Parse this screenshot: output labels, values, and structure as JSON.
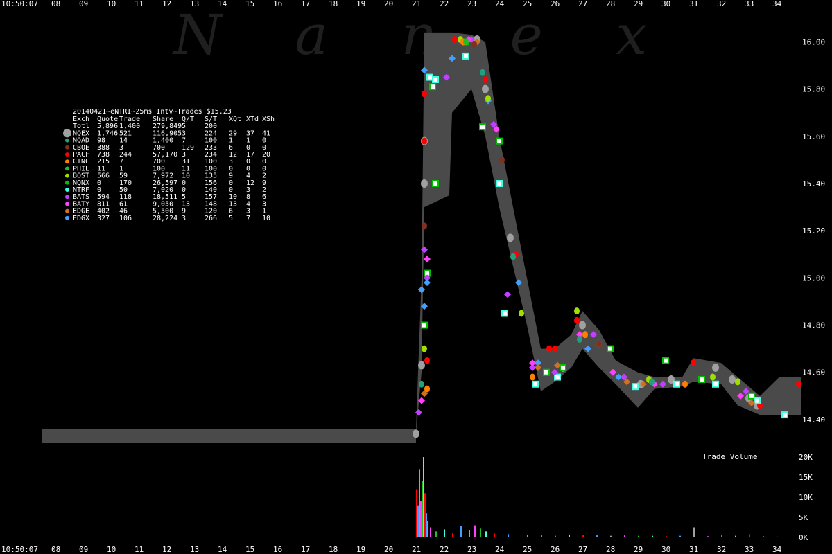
{
  "chart_data": [
    {
      "type": "scatter",
      "title": "20140421~eNTRI~25ms Intv~Trades $15.23",
      "watermark": "N a n e x",
      "time_labels": {
        "top_left": "10:50:07",
        "bottom_left": "10:50:07"
      },
      "x_ticks": [
        "08",
        "09",
        "10",
        "11",
        "12",
        "13",
        "14",
        "15",
        "16",
        "17",
        "18",
        "19",
        "20",
        "21",
        "22",
        "23",
        "24",
        "25",
        "26",
        "27",
        "28",
        "29",
        "30",
        "31",
        "32",
        "33",
        "34"
      ],
      "xlim": [
        7.5,
        35
      ],
      "ylim": [
        14.3,
        16.06
      ],
      "y_ticks": [
        "14.40",
        "14.60",
        "14.80",
        "15.00",
        "15.20",
        "15.40",
        "15.60",
        "15.80",
        "16.00"
      ],
      "colors": {
        "NQEX": "#a0a0a0",
        "NQAD": "#20a080",
        "CBOE": "#803020",
        "PACF": "#ff0000",
        "CINC": "#ff8000",
        "PHIL": "#20c020",
        "BOST": "#a0e000",
        "NQNX": "#00c000",
        "NTRF": "#40ffe0",
        "BATS": "#c040ff",
        "BATY": "#ff40ff",
        "EDGE": "#d07020",
        "EDGX": "#40a0ff",
        "spread": "#4a4a4a"
      },
      "table": {
        "headers": [
          "Exch",
          "Quote",
          "Trade",
          "Share",
          "Q/T",
          "S/T",
          "XQt",
          "XTd",
          "XSh"
        ],
        "total": [
          "Totl",
          "5,896",
          "1,400",
          "279,849",
          "5",
          "200",
          "",
          "",
          ""
        ],
        "rows": [
          [
            "NQEX",
            "1,746",
            "521",
            "116,905",
            "3",
            "224",
            "29",
            "37",
            "41"
          ],
          [
            "NQAD",
            "98",
            "14",
            "1,400",
            "7",
            "100",
            "1",
            "1",
            "0"
          ],
          [
            "CBOE",
            "388",
            "3",
            "700",
            "129",
            "233",
            "6",
            "0",
            "0"
          ],
          [
            "PACF",
            "738",
            "244",
            "57,170",
            "3",
            "234",
            "12",
            "17",
            "20"
          ],
          [
            "CINC",
            "215",
            "7",
            "700",
            "31",
            "100",
            "3",
            "0",
            "0"
          ],
          [
            "PHIL",
            "11",
            "1",
            "100",
            "11",
            "100",
            "0",
            "0",
            "0"
          ],
          [
            "BOST",
            "566",
            "59",
            "7,972",
            "10",
            "135",
            "9",
            "4",
            "2"
          ],
          [
            "NQNX",
            "0",
            "170",
            "26,597",
            "0",
            "156",
            "0",
            "12",
            "9"
          ],
          [
            "NTRF",
            "0",
            "50",
            "7,020",
            "0",
            "140",
            "0",
            "3",
            "2"
          ],
          [
            "BATS",
            "594",
            "118",
            "18,511",
            "5",
            "157",
            "10",
            "8",
            "6"
          ],
          [
            "BATY",
            "811",
            "61",
            "9,050",
            "13",
            "148",
            "13",
            "4",
            "3"
          ],
          [
            "EDGE",
            "402",
            "46",
            "5,500",
            "9",
            "120",
            "6",
            "3",
            "1"
          ],
          [
            "EDGX",
            "327",
            "106",
            "28,224",
            "3",
            "266",
            "5",
            "7",
            "10"
          ]
        ]
      },
      "series": [
        {
          "name": "NQEX",
          "points": [
            [
              21.0,
              14.34
            ],
            [
              21.3,
              15.4
            ],
            [
              21.3,
              15.58
            ],
            [
              21.2,
              14.63
            ],
            [
              23.2,
              16.01
            ],
            [
              23.5,
              15.8
            ],
            [
              24.4,
              15.17
            ],
            [
              26.3,
              14.62
            ],
            [
              27.0,
              14.8
            ],
            [
              29.1,
              14.55
            ],
            [
              30.2,
              14.57
            ],
            [
              31.8,
              14.62
            ],
            [
              32.4,
              14.57
            ],
            [
              33.0,
              14.49
            ],
            [
              33.3,
              14.46
            ]
          ]
        },
        {
          "name": "PACF",
          "points": [
            [
              21.3,
              15.78
            ],
            [
              21.3,
              15.58
            ],
            [
              21.4,
              14.65
            ],
            [
              22.4,
              16.01
            ],
            [
              23.5,
              15.84
            ],
            [
              24.6,
              15.1
            ],
            [
              25.8,
              14.7
            ],
            [
              26.0,
              14.7
            ],
            [
              26.8,
              14.82
            ],
            [
              31.0,
              14.64
            ],
            [
              33.4,
              14.46
            ],
            [
              34.8,
              14.55
            ]
          ]
        },
        {
          "name": "NQNX",
          "points": [
            [
              21.3,
              14.8
            ],
            [
              21.4,
              15.02
            ],
            [
              21.6,
              15.81
            ],
            [
              21.7,
              15.4
            ],
            [
              22.8,
              16.0
            ],
            [
              23.4,
              15.64
            ],
            [
              24.0,
              15.58
            ],
            [
              25.7,
              14.6
            ],
            [
              26.3,
              14.62
            ],
            [
              28.0,
              14.7
            ],
            [
              30.0,
              14.65
            ],
            [
              31.3,
              14.57
            ],
            [
              33.1,
              14.5
            ]
          ]
        },
        {
          "name": "NTRF",
          "points": [
            [
              21.5,
              15.85
            ],
            [
              21.7,
              15.84
            ],
            [
              22.8,
              15.94
            ],
            [
              24.0,
              15.4
            ],
            [
              24.2,
              14.85
            ],
            [
              25.3,
              14.55
            ],
            [
              26.1,
              14.58
            ],
            [
              28.9,
              14.54
            ],
            [
              30.4,
              14.55
            ],
            [
              31.8,
              14.55
            ],
            [
              33.3,
              14.48
            ],
            [
              34.3,
              14.42
            ]
          ]
        },
        {
          "name": "BATS",
          "points": [
            [
              21.1,
              14.43
            ],
            [
              21.3,
              15.12
            ],
            [
              21.4,
              15.0
            ],
            [
              22.1,
              15.85
            ],
            [
              23.0,
              16.01
            ],
            [
              23.8,
              15.65
            ],
            [
              24.3,
              14.93
            ],
            [
              25.2,
              14.62
            ],
            [
              26.0,
              14.6
            ],
            [
              27.4,
              14.76
            ],
            [
              28.5,
              14.58
            ],
            [
              29.9,
              14.55
            ],
            [
              32.9,
              14.52
            ]
          ]
        },
        {
          "name": "BATY",
          "points": [
            [
              21.2,
              14.48
            ],
            [
              21.4,
              15.08
            ],
            [
              22.9,
              16.01
            ],
            [
              23.9,
              15.63
            ],
            [
              25.2,
              14.64
            ],
            [
              26.9,
              14.76
            ],
            [
              28.1,
              14.6
            ],
            [
              29.6,
              14.55
            ],
            [
              32.7,
              14.5
            ]
          ]
        },
        {
          "name": "EDGX",
          "points": [
            [
              21.2,
              14.95
            ],
            [
              21.3,
              15.88
            ],
            [
              21.3,
              14.88
            ],
            [
              21.4,
              14.98
            ],
            [
              22.3,
              15.93
            ],
            [
              23.6,
              15.75
            ],
            [
              24.7,
              14.98
            ],
            [
              25.4,
              14.64
            ],
            [
              27.2,
              14.7
            ],
            [
              28.3,
              14.58
            ]
          ]
        },
        {
          "name": "BOST",
          "points": [
            [
              21.3,
              14.7
            ],
            [
              22.6,
              16.01
            ],
            [
              23.6,
              15.76
            ],
            [
              24.8,
              14.85
            ],
            [
              26.8,
              14.86
            ],
            [
              27.6,
              14.72
            ],
            [
              29.4,
              14.57
            ],
            [
              31.7,
              14.58
            ],
            [
              32.6,
              14.56
            ]
          ]
        },
        {
          "name": "EDGE",
          "points": [
            [
              21.3,
              14.51
            ],
            [
              23.2,
              16.0
            ],
            [
              25.4,
              14.62
            ],
            [
              26.1,
              14.63
            ],
            [
              28.6,
              14.56
            ],
            [
              29.2,
              14.55
            ],
            [
              33.1,
              14.47
            ]
          ]
        },
        {
          "name": "CINC",
          "points": [
            [
              21.4,
              14.53
            ],
            [
              22.7,
              16.0
            ],
            [
              25.2,
              14.58
            ],
            [
              27.1,
              14.76
            ],
            [
              30.7,
              14.55
            ]
          ]
        },
        {
          "name": "NQAD",
          "points": [
            [
              21.2,
              14.55
            ],
            [
              23.4,
              15.87
            ],
            [
              24.5,
              15.09
            ],
            [
              26.9,
              14.74
            ],
            [
              29.5,
              14.56
            ]
          ]
        },
        {
          "name": "CBOE",
          "points": [
            [
              21.3,
              15.22
            ],
            [
              23.1,
              15.99
            ],
            [
              24.1,
              15.5
            ],
            [
              27.6,
              14.72
            ]
          ]
        },
        {
          "name": "PHIL",
          "points": [
            [
              22.8,
              16.0
            ]
          ]
        }
      ]
    },
    {
      "type": "bar",
      "title": "Trade Volume",
      "ylim": [
        0,
        20000
      ],
      "y_ticks": [
        "0K",
        "5K",
        "10K",
        "15K",
        "20K"
      ],
      "bars": [
        [
          21.0,
          12000
        ],
        [
          21.05,
          8000
        ],
        [
          21.1,
          17000
        ],
        [
          21.15,
          9000
        ],
        [
          21.2,
          14000
        ],
        [
          21.25,
          20000
        ],
        [
          21.3,
          11000
        ],
        [
          21.35,
          6000
        ],
        [
          21.4,
          4000
        ],
        [
          21.5,
          2500
        ],
        [
          21.7,
          1500
        ],
        [
          22.0,
          2000
        ],
        [
          22.3,
          1200
        ],
        [
          22.6,
          2800
        ],
        [
          22.9,
          1800
        ],
        [
          23.1,
          3000
        ],
        [
          23.3,
          2200
        ],
        [
          23.5,
          1500
        ],
        [
          23.8,
          1000
        ],
        [
          24.3,
          800
        ],
        [
          25.0,
          600
        ],
        [
          25.5,
          500
        ],
        [
          26.0,
          400
        ],
        [
          26.5,
          700
        ],
        [
          27.0,
          600
        ],
        [
          27.5,
          500
        ],
        [
          28.0,
          400
        ],
        [
          28.5,
          500
        ],
        [
          29.0,
          400
        ],
        [
          29.5,
          400
        ],
        [
          30.0,
          300
        ],
        [
          30.5,
          400
        ],
        [
          31.0,
          2500
        ],
        [
          31.5,
          300
        ],
        [
          32.0,
          500
        ],
        [
          32.5,
          400
        ],
        [
          33.0,
          800
        ],
        [
          33.5,
          300
        ],
        [
          34.0,
          200
        ]
      ]
    }
  ]
}
